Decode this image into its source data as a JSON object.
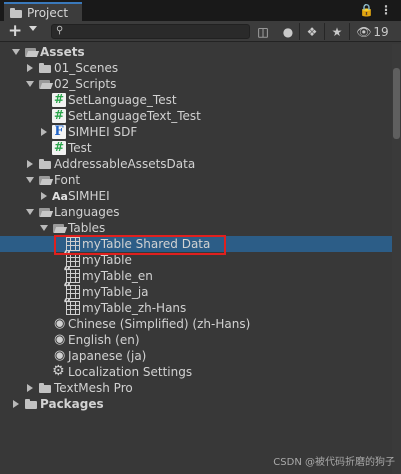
{
  "window": {
    "tab_title": "Project",
    "lock_icon": "lock-icon",
    "menu_icon": "kebab-menu-icon"
  },
  "toolbar": {
    "create_label": "+",
    "search_placeholder": "",
    "hidden_count": "19"
  },
  "tree": [
    {
      "label": "Assets",
      "bold": true,
      "depth": 0,
      "expanded": true,
      "icon": "folder-open-icon"
    },
    {
      "label": "01_Scenes",
      "depth": 1,
      "expanded": false,
      "icon": "folder-icon"
    },
    {
      "label": "02_Scripts",
      "depth": 1,
      "expanded": true,
      "icon": "folder-open-icon"
    },
    {
      "label": "SetLanguage_Test",
      "depth": 2,
      "icon": "csharp-script-icon"
    },
    {
      "label": "SetLanguageText_Test",
      "depth": 2,
      "icon": "csharp-script-icon"
    },
    {
      "label": "SIMHEI SDF",
      "depth": 2,
      "expanded": false,
      "icon": "font-asset-icon"
    },
    {
      "label": "Test",
      "depth": 2,
      "icon": "csharp-script-icon"
    },
    {
      "label": "AddressableAssetsData",
      "depth": 1,
      "expanded": false,
      "icon": "folder-icon"
    },
    {
      "label": "Font",
      "depth": 1,
      "expanded": true,
      "icon": "folder-open-icon"
    },
    {
      "label": "SIMHEI",
      "depth": 2,
      "expanded": false,
      "icon": "font-icon"
    },
    {
      "label": "Languages",
      "depth": 1,
      "expanded": true,
      "icon": "folder-open-icon"
    },
    {
      "label": "Tables",
      "depth": 2,
      "expanded": true,
      "icon": "folder-open-icon"
    },
    {
      "label": "myTable Shared Data",
      "depth": 3,
      "icon": "table-icon",
      "selected": true
    },
    {
      "label": "myTable",
      "depth": 3,
      "icon": "string-table-icon"
    },
    {
      "label": "myTable_en",
      "depth": 3,
      "icon": "string-table-icon"
    },
    {
      "label": "myTable_ja",
      "depth": 3,
      "icon": "string-table-icon"
    },
    {
      "label": "myTable_zh-Hans",
      "depth": 3,
      "icon": "string-table-icon"
    },
    {
      "label": "Chinese (Simplified) (zh-Hans)",
      "depth": 2,
      "icon": "locale-pin-icon"
    },
    {
      "label": "English (en)",
      "depth": 2,
      "icon": "locale-pin-icon"
    },
    {
      "label": "Japanese (ja)",
      "depth": 2,
      "icon": "locale-pin-icon"
    },
    {
      "label": "Localization Settings",
      "depth": 2,
      "icon": "settings-gear-icon"
    },
    {
      "label": "TextMesh Pro",
      "depth": 1,
      "expanded": false,
      "icon": "folder-icon"
    },
    {
      "label": "Packages",
      "bold": true,
      "depth": 0,
      "expanded": false,
      "icon": "folder-icon"
    }
  ],
  "watermark": "CSDN @被代码折磨的狗子",
  "colors": {
    "selection": "#2c5d87",
    "highlight_border": "#e0201e",
    "panel_bg": "#383838"
  }
}
